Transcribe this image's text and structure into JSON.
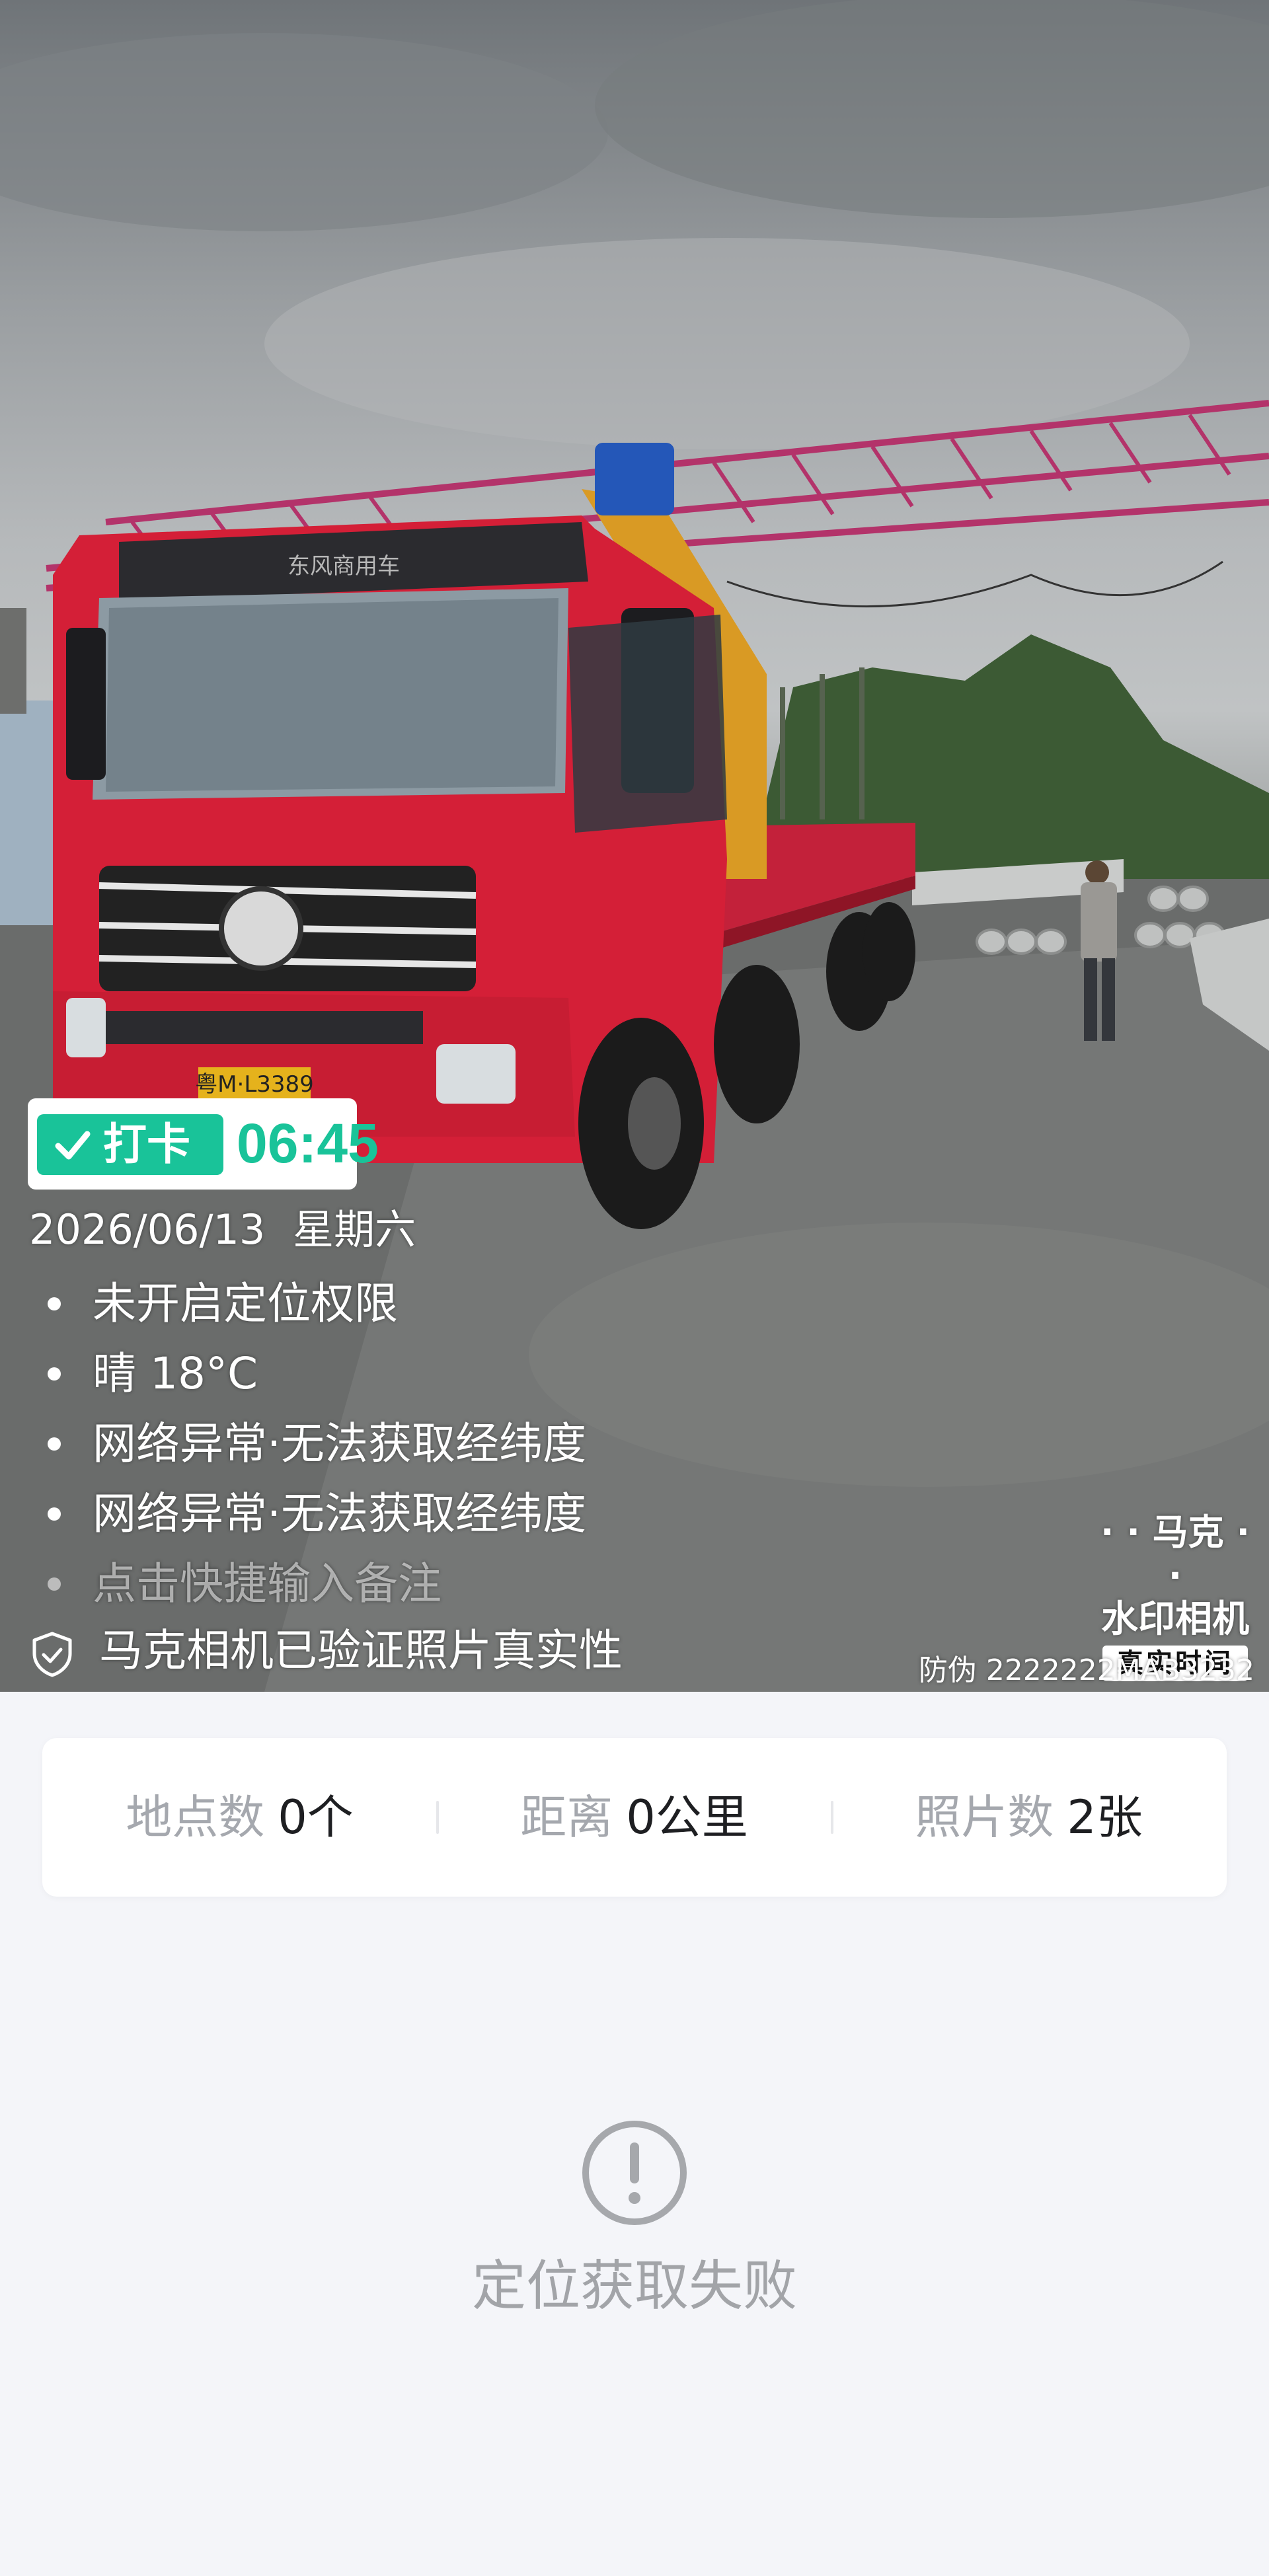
{
  "photo": {
    "description_icon": "truck-crane-photo",
    "truck_cab_text": "东风商用车",
    "plate_text": "粤M·L3389"
  },
  "watermark": {
    "checkin_label": "打卡",
    "checkin_time": "06:45",
    "date": "2026/06/13",
    "weekday": "星期六",
    "items": [
      "未开启定位权限",
      "晴 18°C",
      "网络异常·无法获取经纬度",
      "网络异常·无法获取经纬度"
    ],
    "note_hint": "点击快捷输入备注",
    "verified_text": "马克相机已验证照片真实性",
    "brand_line1": "· · 马克 · ·",
    "brand_line2": "水印相机",
    "brand_badge": "真实时间",
    "antifake": "防伪 2222222MAB3232",
    "accent_color": "#19c399"
  },
  "stats": [
    {
      "key": "地点数",
      "value": "0个"
    },
    {
      "key": "距离",
      "value": "0公里"
    },
    {
      "key": "照片数",
      "value": "2张"
    }
  ],
  "empty_state": {
    "icon": "exclamation-circle-icon",
    "message": "定位获取失败"
  }
}
